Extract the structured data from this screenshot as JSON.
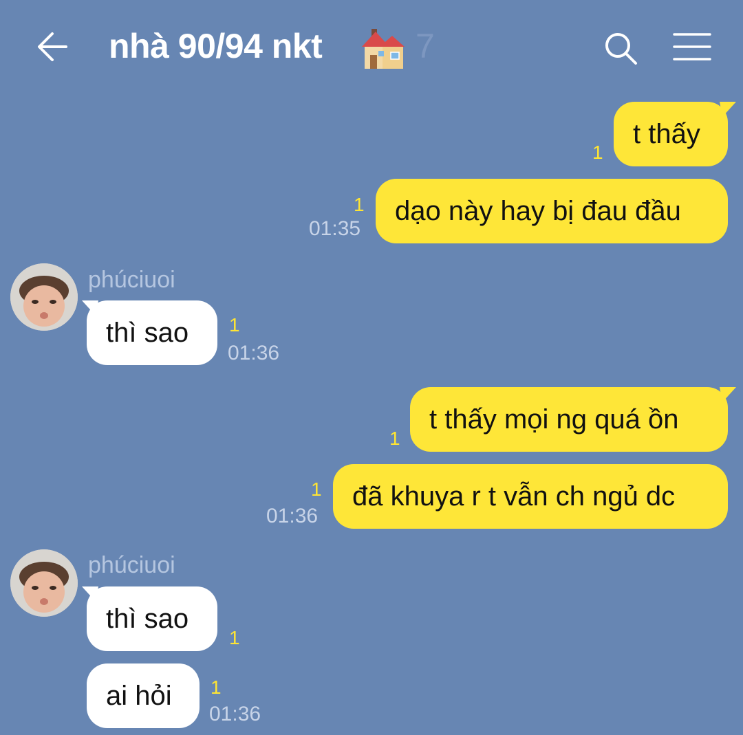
{
  "header": {
    "title": "nhà 90/94 nkt",
    "member_count": "7",
    "icons": {
      "back": "back-arrow-icon",
      "house": "house-emoji-icon",
      "search": "search-icon",
      "menu": "hamburger-menu-icon"
    }
  },
  "colors": {
    "background": "#6786b3",
    "my_bubble": "#fee638",
    "their_bubble": "#ffffff",
    "unread_count": "#ffe533"
  },
  "messages": [
    {
      "direction": "outgoing",
      "text": "t thấy",
      "unread": "1",
      "time": ""
    },
    {
      "direction": "outgoing",
      "text": "dạo này hay bị đau đầu",
      "unread": "1",
      "time": "01:35"
    },
    {
      "direction": "incoming",
      "sender": "phúciuoi",
      "text": "thì sao",
      "unread": "1",
      "time": "01:36"
    },
    {
      "direction": "outgoing",
      "text": "t thấy mọi ng quá ồn",
      "unread": "1",
      "time": ""
    },
    {
      "direction": "outgoing",
      "text": "đã khuya r t vẫn ch ngủ dc",
      "unread": "1",
      "time": "01:36"
    },
    {
      "direction": "incoming",
      "sender": "phúciuoi",
      "text": "thì sao",
      "unread": "1",
      "time": ""
    },
    {
      "direction": "incoming",
      "text": "ai hỏi",
      "unread": "1",
      "time": "01:36"
    }
  ]
}
